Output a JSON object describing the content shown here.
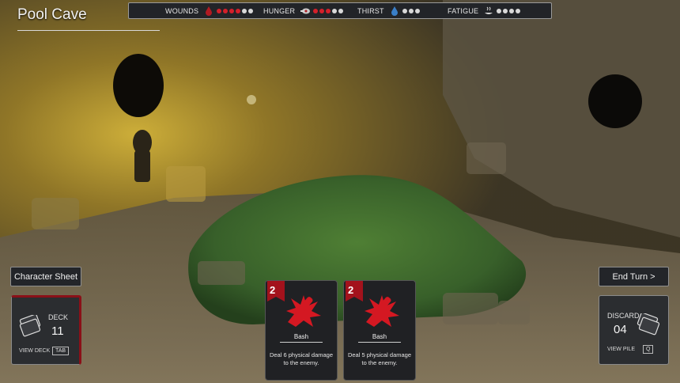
{
  "location": {
    "title": "Pool Cave"
  },
  "status": [
    {
      "label": "WOUNDS",
      "icon": "blood-drop-icon",
      "filled": 4,
      "total": 6
    },
    {
      "label": "HUNGER",
      "icon": "meat-icon",
      "filled": 3,
      "total": 5
    },
    {
      "label": "THIRST",
      "icon": "water-drop-icon",
      "filled": 0,
      "total": 3
    },
    {
      "label": "FATIGUE",
      "icon": "rest-icon",
      "filled": 0,
      "total": 4
    }
  ],
  "buttons": {
    "character_sheet": "Character Sheet",
    "end_turn": "End Turn >"
  },
  "deck": {
    "label": "DECK",
    "count": "11",
    "view": "VIEW DECK",
    "key": "TAB"
  },
  "discard": {
    "label": "DISCARD",
    "count": "04",
    "view": "VIEW PILE",
    "key": "Q"
  },
  "hand": [
    {
      "cost": "2",
      "name": "Bash",
      "description": "Deal 6 physical damage to the enemy.",
      "art": "club-strike-icon"
    },
    {
      "cost": "2",
      "name": "Bash",
      "description": "Deal 5 physical damage to the enemy.",
      "art": "club-strike-icon"
    }
  ],
  "colors": {
    "accent_red": "#d4202a",
    "pool_green": "#3f6a2c",
    "torch_yellow": "#c9a52a"
  }
}
